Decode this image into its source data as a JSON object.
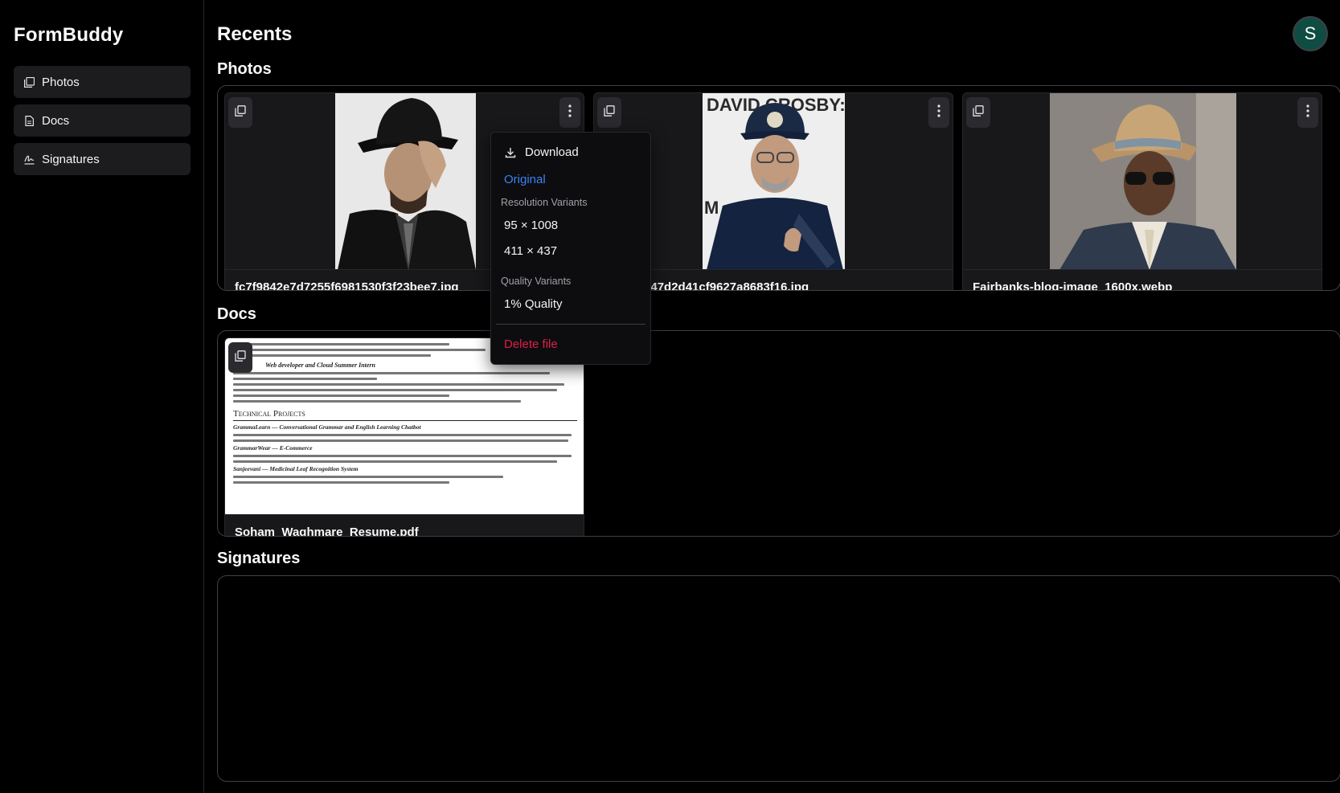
{
  "app": {
    "title": "FormBuddy"
  },
  "sidebar": {
    "items": [
      {
        "label": "Photos",
        "icon": "images-icon"
      },
      {
        "label": "Docs",
        "icon": "file-icon"
      },
      {
        "label": "Signatures",
        "icon": "signature-icon"
      }
    ]
  },
  "header": {
    "title": "Recents",
    "avatar_initial": "S"
  },
  "sections": {
    "photos": "Photos",
    "docs": "Docs",
    "signatures": "Signatures"
  },
  "photos": [
    {
      "filename": "fc7f9842e7d7255f6981530f3f23bee7.jpg"
    },
    {
      "filename": "…2d5de47d2d41cf9627a8683f16.jpg",
      "sign_text": "DAVID CROSBY:"
    },
    {
      "filename": "Fairbanks-blog-image_1600x.webp"
    }
  ],
  "docs": [
    {
      "filename": "Soham_Waghmare_Resume.pdf",
      "heading": "Technical Projects",
      "role": "Web developer and Cloud Summer Intern",
      "projects": [
        "GrammaLearn — Conversational Grammar and English Learning Chatbot",
        "GrammarWear — E-Commerce",
        "Sanjeevani — Medicinal Leaf Recognition System"
      ]
    }
  ],
  "context_menu": {
    "download": "Download",
    "original": "Original",
    "resolution_label": "Resolution Variants",
    "resolutions": [
      "95 × 1008",
      "411 × 437"
    ],
    "quality_label": "Quality Variants",
    "qualities": [
      "1% Quality"
    ],
    "delete": "Delete file"
  },
  "colors": {
    "background": "#000000",
    "card": "#18181b",
    "accent_link": "#3b82f6",
    "danger": "#e11d48",
    "avatar": "#0f4d43"
  }
}
